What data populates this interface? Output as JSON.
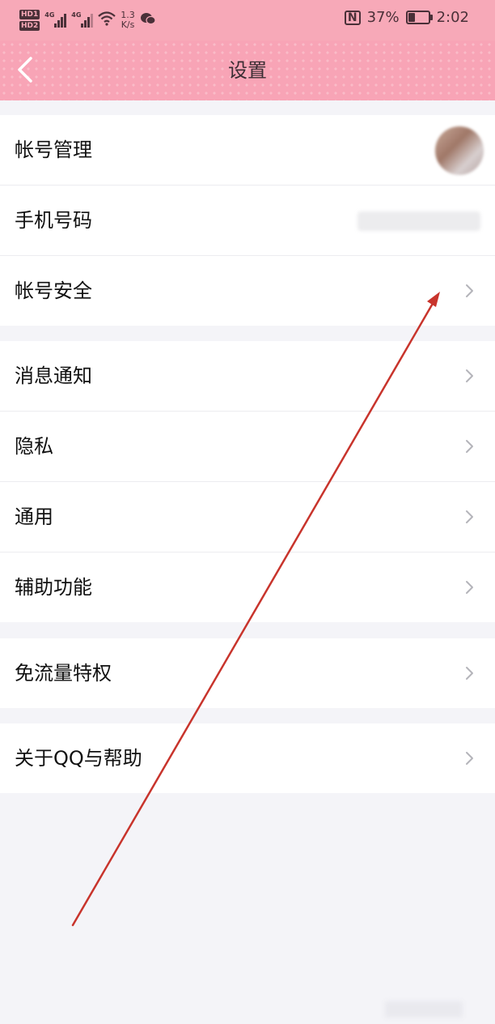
{
  "status_bar": {
    "sim1": "HD1",
    "sim2": "HD2",
    "net1": "4G",
    "net2": "4G",
    "speed_value": "1.3",
    "speed_unit": "K/s",
    "battery_percent": "37%",
    "battery_level": 0.37,
    "time": "2:02"
  },
  "header": {
    "title": "设置",
    "back_icon": "chevron-left-icon"
  },
  "groups": [
    {
      "items": [
        {
          "label": "帐号管理",
          "trailing": "avatar"
        },
        {
          "label": "手机号码",
          "trailing": "masked-value"
        },
        {
          "label": "帐号安全",
          "trailing": "chevron-right-icon"
        }
      ]
    },
    {
      "items": [
        {
          "label": "消息通知",
          "trailing": "chevron-right-icon"
        },
        {
          "label": "隐私",
          "trailing": "chevron-right-icon"
        },
        {
          "label": "通用",
          "trailing": "chevron-right-icon"
        },
        {
          "label": "辅助功能",
          "trailing": "chevron-right-icon"
        }
      ]
    },
    {
      "items": [
        {
          "label": "免流量特权",
          "trailing": "chevron-right-icon"
        }
      ]
    },
    {
      "items": [
        {
          "label": "关于QQ与帮助",
          "trailing": "chevron-right-icon"
        }
      ]
    }
  ],
  "colors": {
    "header_bg": "#f8a4b6",
    "page_bg": "#f4f4f8",
    "annotation": "#c8342c"
  }
}
